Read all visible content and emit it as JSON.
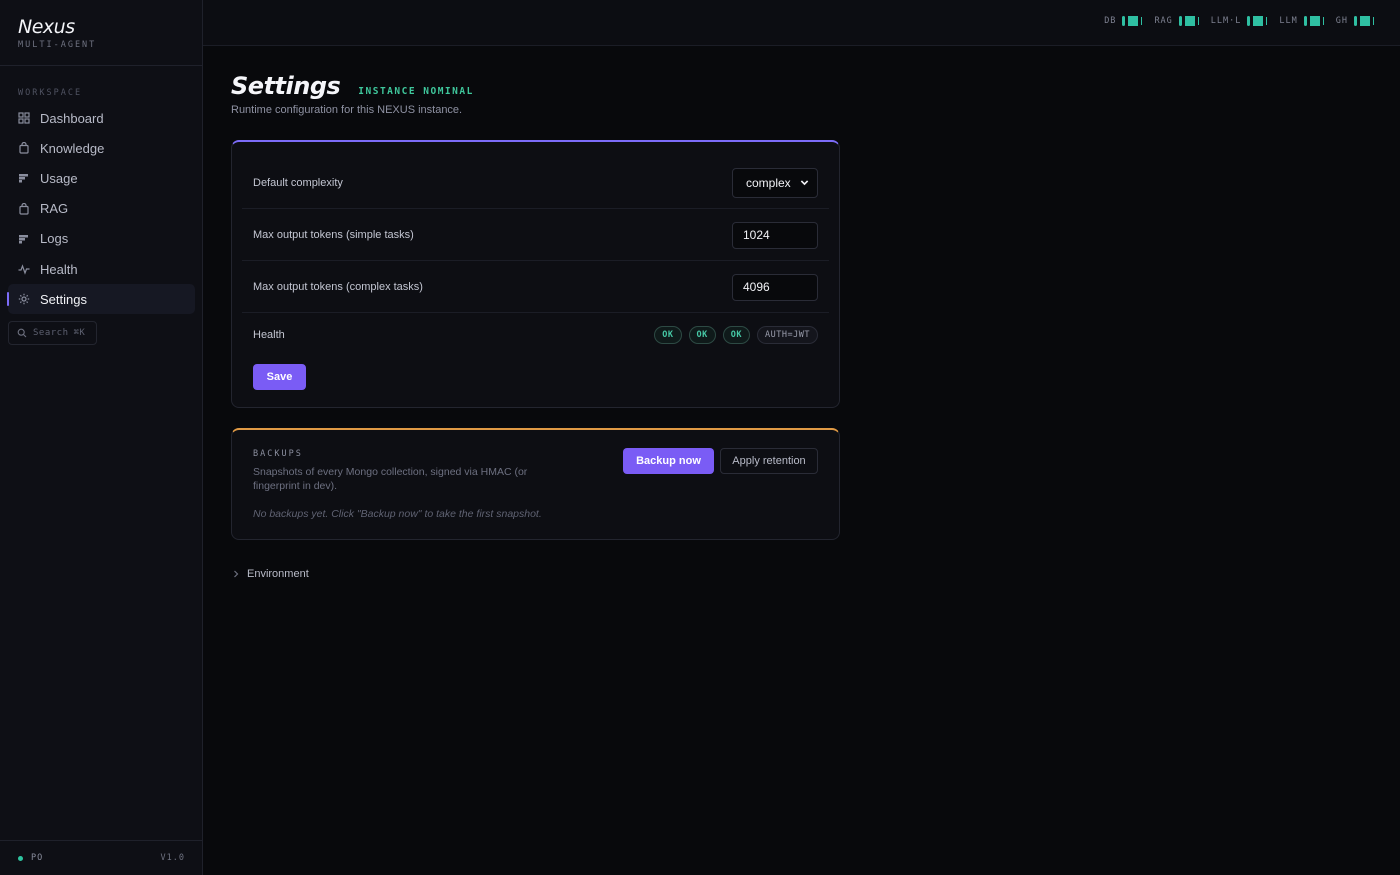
{
  "brand": {
    "title": "Nexus",
    "subtitle": "MULTI-AGENT"
  },
  "sidebar": {
    "section_label": "WORKSPACE",
    "items": [
      {
        "label": "Dashboard",
        "icon": "grid-icon"
      },
      {
        "label": "Knowledge",
        "icon": "bag-icon"
      },
      {
        "label": "Usage",
        "icon": "bars-icon"
      },
      {
        "label": "RAG",
        "icon": "bag-icon"
      },
      {
        "label": "Logs",
        "icon": "bars-icon"
      },
      {
        "label": "Health",
        "icon": "pulse-icon"
      },
      {
        "label": "Settings",
        "icon": "gear-icon",
        "active": true
      }
    ],
    "search": {
      "label": "Search",
      "shortcut": "⌘K"
    },
    "footer": {
      "env": "PO",
      "version": "V1.0"
    }
  },
  "topbar": {
    "services": [
      {
        "name": "DB",
        "status": "ok"
      },
      {
        "name": "RAG",
        "status": "ok"
      },
      {
        "name": "LLM·L",
        "status": "ok"
      },
      {
        "name": "LLM",
        "status": "ok"
      },
      {
        "name": "GH",
        "status": "ok"
      }
    ]
  },
  "page": {
    "title": "Settings",
    "status": "INSTANCE NOMINAL",
    "subtitle": "Runtime configuration for this NEXUS instance."
  },
  "settings": {
    "default_complexity": {
      "label": "Default complexity",
      "value": "complex",
      "options": [
        "complex"
      ]
    },
    "max_simple": {
      "label": "Max output tokens (simple tasks)",
      "value": "1024"
    },
    "max_complex": {
      "label": "Max output tokens (complex tasks)",
      "value": "4096"
    },
    "health": {
      "label": "Health",
      "pills": [
        "OK",
        "OK",
        "OK"
      ],
      "auth": "AUTH=JWT"
    },
    "save_label": "Save"
  },
  "backups": {
    "label": "BACKUPS",
    "description": "Snapshots of every Mongo collection, signed via HMAC (or fingerprint in dev).",
    "empty": "No backups yet. Click \"Backup now\" to take the first snapshot.",
    "backup_now": "Backup now",
    "apply_retention": "Apply retention"
  },
  "environment": {
    "label": "Environment"
  },
  "colors": {
    "accent": "#7a5cf5",
    "ok": "#2fbfa2",
    "warn": "#e09a45",
    "background": "#08090c"
  }
}
